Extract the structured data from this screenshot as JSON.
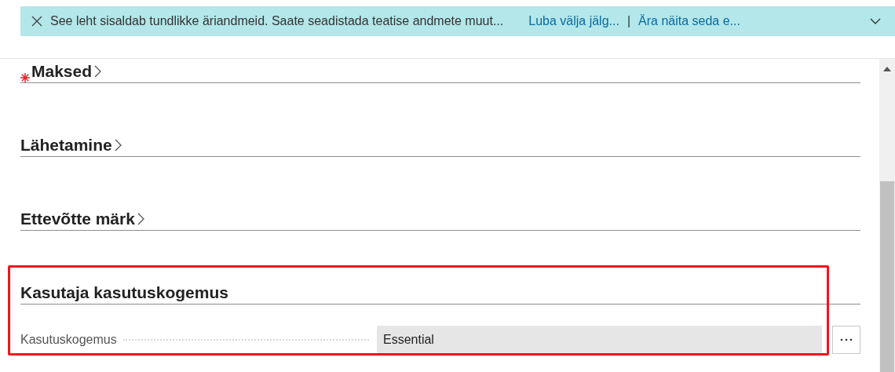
{
  "banner": {
    "message": "See leht sisaldab tundlikke äriandmeid. Saate seadistada teatise andmete muut...",
    "actions": [
      "Luba välja jälg...",
      "Ära näita seda e..."
    ],
    "separator": "|",
    "expanded": false
  },
  "sections": [
    {
      "title": "Maksed",
      "required": true,
      "expanded": false
    },
    {
      "title": "Lähetamine",
      "required": false,
      "expanded": false
    },
    {
      "title": "Ettevõtte märk",
      "required": false,
      "expanded": false
    },
    {
      "title": "Kasutaja kasutuskogemus",
      "required": false,
      "expanded": true,
      "highlighted": true,
      "fields": [
        {
          "label": "Kasutuskogemus",
          "value": "Essential",
          "disabled": true
        }
      ]
    }
  ]
}
